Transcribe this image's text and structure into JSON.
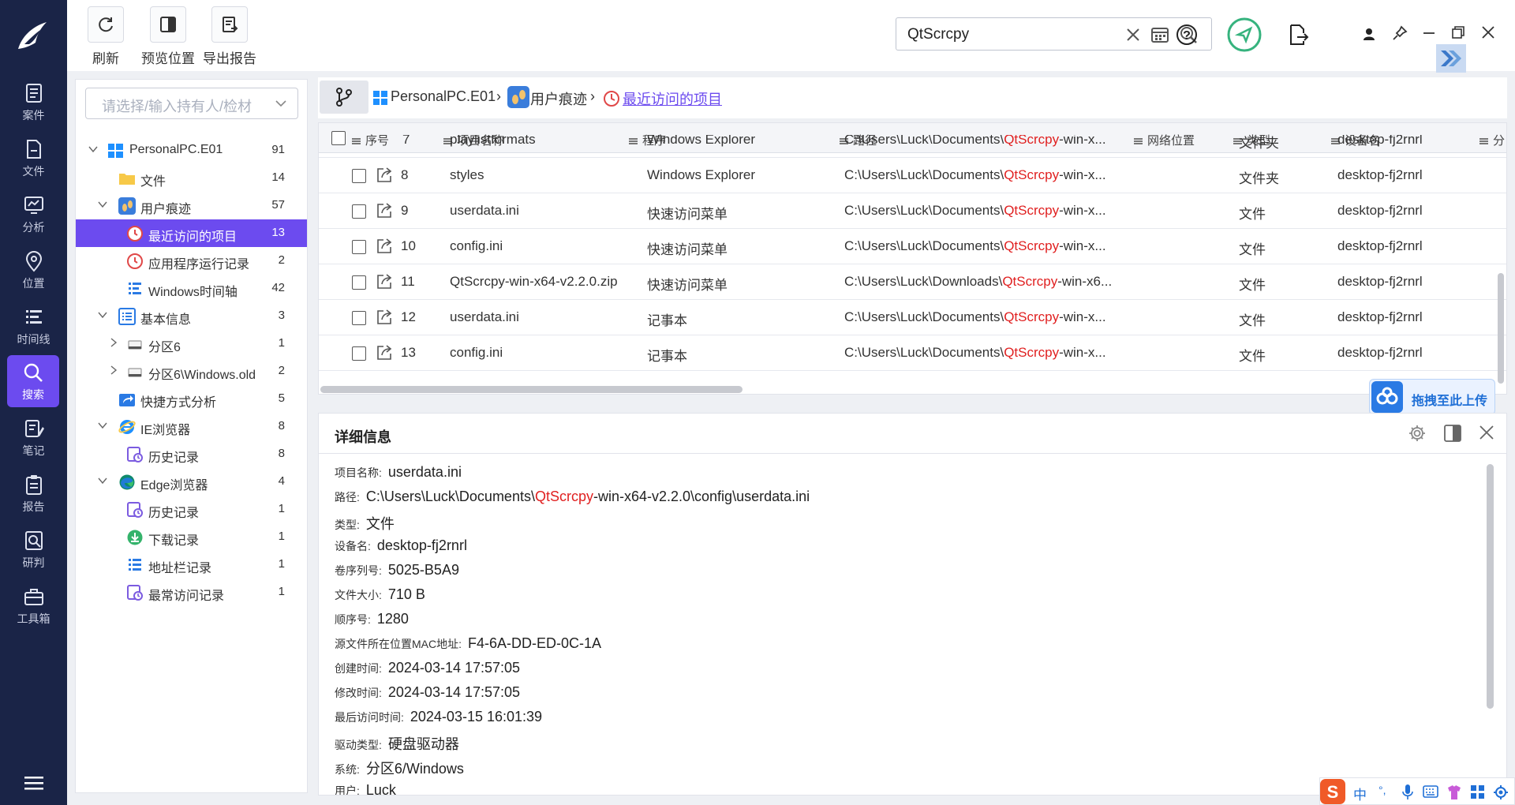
{
  "nav": {
    "items": [
      {
        "label": "案件",
        "icon": "case-icon"
      },
      {
        "label": "文件",
        "icon": "file-icon"
      },
      {
        "label": "分析",
        "icon": "analysis-icon"
      },
      {
        "label": "位置",
        "icon": "location-icon"
      },
      {
        "label": "时间线",
        "icon": "timeline-icon"
      },
      {
        "label": "搜索",
        "icon": "search-icon",
        "active": true
      },
      {
        "label": "笔记",
        "icon": "note-icon"
      },
      {
        "label": "报告",
        "icon": "report-icon"
      },
      {
        "label": "研判",
        "icon": "judge-icon"
      },
      {
        "label": "工具箱",
        "icon": "toolbox-icon"
      }
    ]
  },
  "toolbar": {
    "refresh_label": "刷新",
    "preview_label": "预览位置",
    "export_label": "导出报告",
    "search_value": "QtScrcpy"
  },
  "left_panel": {
    "owner_placeholder": "请选择/输入持有人/检材",
    "tree": [
      {
        "label": "PersonalPC.E01",
        "count": "91",
        "icon": "windows-icon",
        "level": 0,
        "expand": "open"
      },
      {
        "label": "文件",
        "count": "14",
        "icon": "folder-icon",
        "level": 1,
        "expand": "none"
      },
      {
        "label": "用户痕迹",
        "count": "57",
        "icon": "footprint-icon",
        "level": 1,
        "expand": "open"
      },
      {
        "label": "最近访问的项目",
        "count": "13",
        "icon": "recent-icon",
        "level": 2,
        "expand": "none",
        "selected": true
      },
      {
        "label": "应用程序运行记录",
        "count": "2",
        "icon": "app-run-icon",
        "level": 2,
        "expand": "none"
      },
      {
        "label": "Windows时间轴",
        "count": "42",
        "icon": "timeline-icon",
        "level": 2,
        "expand": "none"
      },
      {
        "label": "基本信息",
        "count": "3",
        "icon": "info-list-icon",
        "level": 1,
        "expand": "open"
      },
      {
        "label": "分区6",
        "count": "1",
        "icon": "disk-icon",
        "level": 2,
        "expand": "closed"
      },
      {
        "label": "分区6\\Windows.old",
        "count": "2",
        "icon": "disk-icon",
        "level": 2,
        "expand": "closed"
      },
      {
        "label": "快捷方式分析",
        "count": "5",
        "icon": "shortcut-icon",
        "level": 1,
        "expand": "none"
      },
      {
        "label": "IE浏览器",
        "count": "8",
        "icon": "ie-icon",
        "level": 1,
        "expand": "open"
      },
      {
        "label": "历史记录",
        "count": "8",
        "icon": "history-icon",
        "level": 2,
        "expand": "none"
      },
      {
        "label": "Edge浏览器",
        "count": "4",
        "icon": "edge-icon",
        "level": 1,
        "expand": "open"
      },
      {
        "label": "历史记录",
        "count": "1",
        "icon": "history-icon",
        "level": 2,
        "expand": "none"
      },
      {
        "label": "下载记录",
        "count": "1",
        "icon": "download-icon",
        "level": 2,
        "expand": "none"
      },
      {
        "label": "地址栏记录",
        "count": "1",
        "icon": "addressbar-icon",
        "level": 2,
        "expand": "none"
      },
      {
        "label": "最常访问记录",
        "count": "1",
        "icon": "frequent-icon",
        "level": 2,
        "expand": "none"
      }
    ]
  },
  "breadcrumb": {
    "root": "PersonalPC.E01",
    "mid": "用户痕迹",
    "current": "最近访问的项目",
    "sep": "›"
  },
  "table": {
    "columns": [
      "序号",
      "项目名称",
      "程序",
      "路径",
      "网络位置",
      "类型",
      "设备名",
      "分"
    ],
    "partial_row": {
      "no": "7",
      "name": "playlistformats",
      "program": "Windows Explorer",
      "path_pre": "C:\\Users\\Luck\\Documents\\",
      "path_hl": "QtScrcpy",
      "path_post": "-win-x...",
      "type": "文件夹",
      "device": "desktop-fj2rnrl"
    },
    "rows": [
      {
        "no": "8",
        "name": "styles",
        "program": "Windows Explorer",
        "path_pre": "C:\\Users\\Luck\\Documents\\",
        "path_hl": "QtScrcpy",
        "path_post": "-win-x...",
        "type": "文件夹",
        "device": "desktop-fj2rnrl"
      },
      {
        "no": "9",
        "name": "userdata.ini",
        "program": "快速访问菜单",
        "path_pre": "C:\\Users\\Luck\\Documents\\",
        "path_hl": "QtScrcpy",
        "path_post": "-win-x...",
        "type": "文件",
        "device": "desktop-fj2rnrl"
      },
      {
        "no": "10",
        "name": "config.ini",
        "program": "快速访问菜单",
        "path_pre": "C:\\Users\\Luck\\Documents\\",
        "path_hl": "QtScrcpy",
        "path_post": "-win-x...",
        "type": "文件",
        "device": "desktop-fj2rnrl"
      },
      {
        "no": "11",
        "name": "QtScrcpy-win-x64-v2.2.0.zip",
        "program": "快速访问菜单",
        "path_pre": "C:\\Users\\Luck\\Downloads\\",
        "path_hl": "QtScrcpy",
        "path_post": "-win-x6...",
        "type": "文件",
        "device": "desktop-fj2rnrl"
      },
      {
        "no": "12",
        "name": "userdata.ini",
        "program": "记事本",
        "path_pre": "C:\\Users\\Luck\\Documents\\",
        "path_hl": "QtScrcpy",
        "path_post": "-win-x...",
        "type": "文件",
        "device": "desktop-fj2rnrl"
      },
      {
        "no": "13",
        "name": "config.ini",
        "program": "记事本",
        "path_pre": "C:\\Users\\Luck\\Documents\\",
        "path_hl": "QtScrcpy",
        "path_post": "-win-x...",
        "type": "文件",
        "device": "desktop-fj2rnrl"
      }
    ]
  },
  "upload": {
    "label": "拖拽至此上传"
  },
  "detail": {
    "title": "详细信息",
    "fields": [
      {
        "key": "项目名称:",
        "value": "userdata.ini"
      },
      {
        "key": "路径:",
        "value_pre": "C:\\Users\\Luck\\Documents\\",
        "value_hl": "QtScrcpy",
        "value_post": "-win-x64-v2.2.0\\config\\userdata.ini"
      },
      {
        "key": "类型:",
        "value": "文件"
      },
      {
        "key": "设备名:",
        "value": "desktop-fj2rnrl"
      },
      {
        "key": "卷序列号:",
        "value": "5025-B5A9"
      },
      {
        "key": "文件大小:",
        "value": "710 B"
      },
      {
        "key": "顺序号:",
        "value": "1280"
      },
      {
        "key": "源文件所在位置MAC地址:",
        "value": "F4-6A-DD-ED-0C-1A"
      },
      {
        "key": "创建时间:",
        "value": "2024-03-14 17:57:05"
      },
      {
        "key": "修改时间:",
        "value": "2024-03-14 17:57:05"
      },
      {
        "key": "最后访问时间:",
        "value": "2024-03-15 16:01:39"
      },
      {
        "key": "驱动类型:",
        "value": "硬盘驱动器"
      },
      {
        "key": "系统:",
        "value": "分区6/Windows"
      },
      {
        "key": "用户:",
        "value": "Luck"
      }
    ]
  },
  "ime": {
    "lang": "中",
    "punct": "°,"
  },
  "colors": {
    "accent": "#6c4bef",
    "nav_bg": "#1a2447",
    "highlight": "#e02020",
    "link": "#6c4bef",
    "green": "#36b37e"
  }
}
